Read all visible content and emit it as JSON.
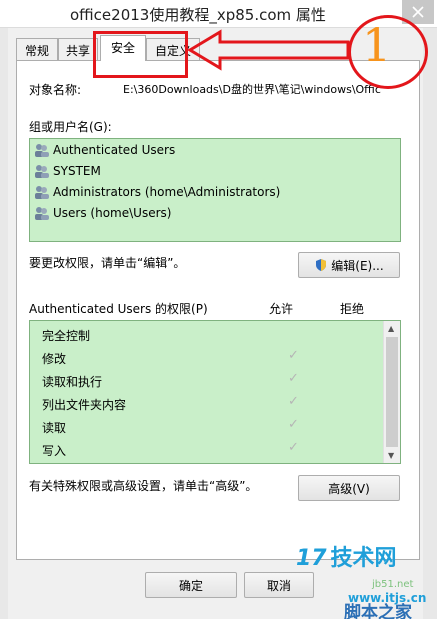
{
  "window": {
    "title": "office2013使用教程_xp85.com 属性"
  },
  "tabs": [
    {
      "label": "常规"
    },
    {
      "label": "共享"
    },
    {
      "label": "安全"
    },
    {
      "label": "自定义"
    }
  ],
  "security": {
    "object_name_label": "对象名称:",
    "object_name_value": "E:\\360Downloads\\D盘的世界\\笔记\\windows\\Offic",
    "groups_label": "组或用户名(G):",
    "groups": [
      {
        "name": "Authenticated Users"
      },
      {
        "name": "SYSTEM"
      },
      {
        "name": "Administrators (home\\Administrators)"
      },
      {
        "name": "Users (home\\Users)"
      }
    ],
    "edit_hint": "要更改权限，请单击“编辑”。",
    "edit_button": "编辑(E)...",
    "permissions_label": "Authenticated Users 的权限(P)",
    "allow_header": "允许",
    "deny_header": "拒绝",
    "permissions": [
      {
        "name": "完全控制",
        "allow": false
      },
      {
        "name": "修改",
        "allow": true
      },
      {
        "name": "读取和执行",
        "allow": true
      },
      {
        "name": "列出文件夹内容",
        "allow": true
      },
      {
        "name": "读取",
        "allow": true
      },
      {
        "name": "写入",
        "allow": true
      }
    ],
    "advanced_hint": "有关特殊权限或高级设置，请单击“高级”。",
    "advanced_button": "高级(V)"
  },
  "footer": {
    "ok_button": "确定",
    "cancel_button": "取消"
  },
  "annotation": {
    "step_number": "1",
    "color": "#e3161b",
    "number_color": "#f7941d"
  },
  "watermarks": {
    "site_logo_num": "17",
    "site_logo_text": "技术网",
    "site_url_1": "jb51.net",
    "site_url_2": "www.itjs.cn",
    "site_name": "脚本之家"
  }
}
